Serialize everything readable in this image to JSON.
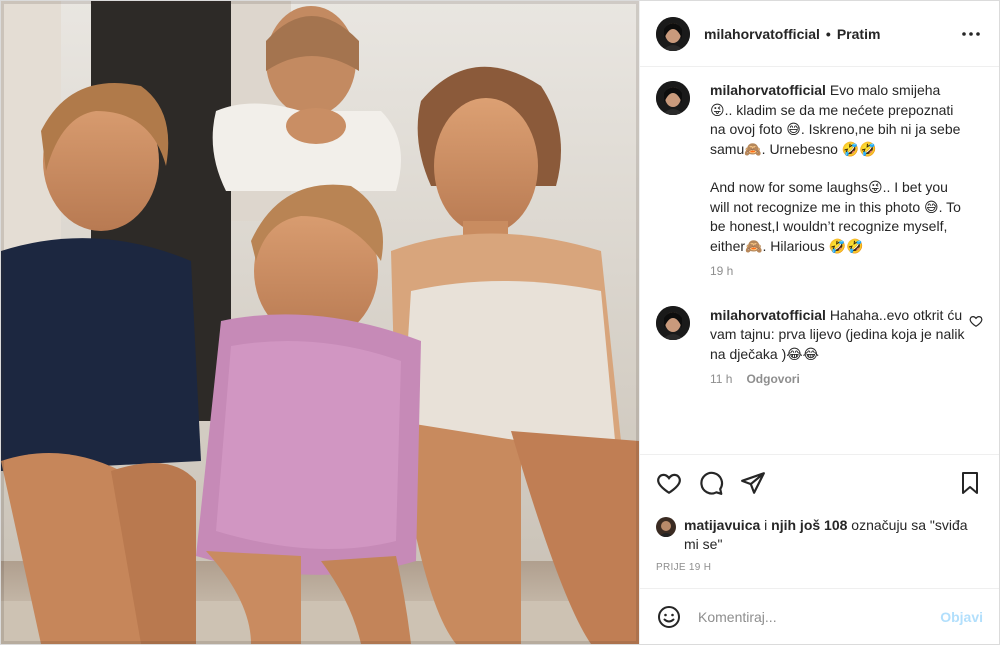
{
  "post": {
    "username": "milahorvatofficial",
    "dot": "•",
    "follow_state": "Pratim"
  },
  "caption": {
    "username": "milahorvatofficial",
    "lines_hr": "Evo malo smijeha 😜.. kladim se da me nećete prepoznati na ovoj foto 😅. Iskreno,ne bih ni ja sebe samu🙈. Urnebesno 🤣🤣",
    "lines_en": "And now for some laughs😜.. I bet you will not recognize me in this photo 😅. To be honest,I wouldn’t recognize myself, either🙈. Hilarious 🤣🤣",
    "time": "19 h"
  },
  "reply": {
    "username": "milahorvatofficial",
    "text": "Hahaha..evo otkrit ću vam tajnu: prva lijevo (jedina koja je nalik na dječaka )😂😂",
    "time": "11 h",
    "reply_label": "Odgovori"
  },
  "likes": {
    "first_user": "matijavuica",
    "middle": " i ",
    "others": "njih još 108",
    "suffix": " označuju sa \"sviđa mi se\""
  },
  "posted_ago": "PRIJE 19 H",
  "comment_box": {
    "placeholder": "Komentiraj...",
    "post_label": "Objavi"
  },
  "colors": {
    "accent": "#0095f6",
    "post_disabled": "#b2dffc",
    "muted": "#8e8e8e"
  }
}
